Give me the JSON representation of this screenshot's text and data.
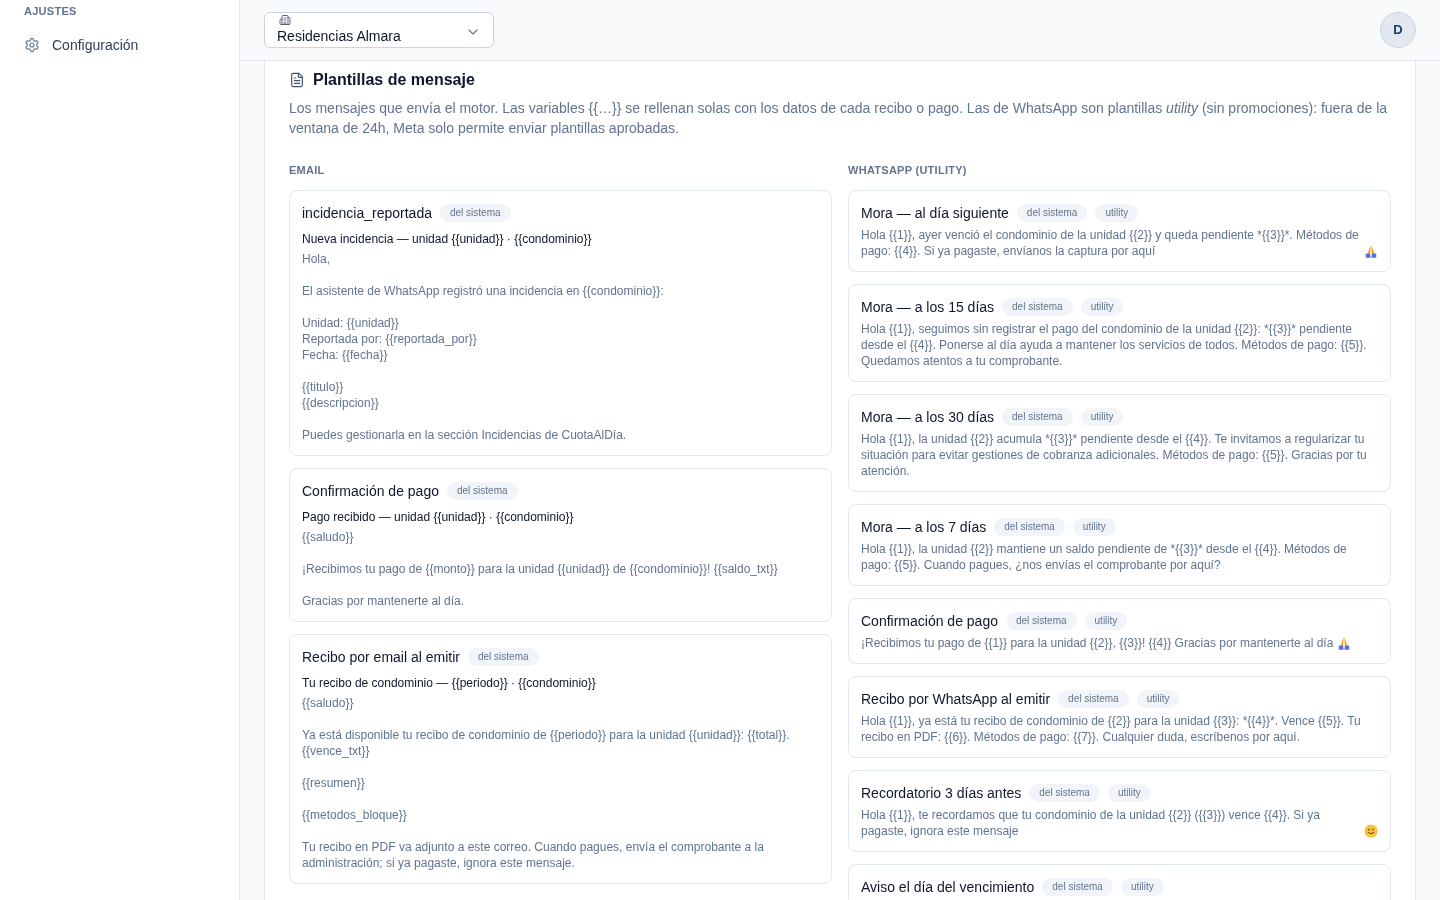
{
  "sidebar": {
    "section_label": "AJUSTES",
    "items": [
      {
        "label": "Configuración"
      }
    ]
  },
  "header": {
    "property_select": {
      "value": "Residencias Almara"
    },
    "avatar": {
      "initial": "D"
    }
  },
  "panel": {
    "title": "Plantillas de mensaje",
    "description": "Los mensajes que envía el motor. Las variables {{…}} se rellenan solas con los datos de cada recibo o pago. Las de WhatsApp son plantillas *utility* (sin promociones): fuera de la ventana de 24h, Meta solo permite enviar plantillas aprobadas.",
    "columns": [
      {
        "heading": "EMAIL",
        "templates": [
          {
            "name": "incidencia_reportada",
            "badges": [
              "del sistema"
            ],
            "subject": "Nueva incidencia — unidad {{unidad}} · {{condominio}}",
            "body": "Hola,\n\nEl asistente de WhatsApp registró una incidencia en {{condominio}}:\n\nUnidad: {{unidad}}\nReportada por: {{reportada_por}}\nFecha: {{fecha}}\n\n{{titulo}}\n{{descripcion}}\n\nPuedes gestionarla en la sección Incidencias de CuotaAlDía."
          },
          {
            "name": "Confirmación de pago",
            "badges": [
              "del sistema"
            ],
            "subject": "Pago recibido — unidad {{unidad}} · {{condominio}}",
            "body": "{{saludo}}\n\n¡Recibimos tu pago de {{monto}} para la unidad {{unidad}} de {{condominio}}! {{saldo_txt}}\n\nGracias por mantenerte al día."
          },
          {
            "name": "Recibo por email al emitir",
            "badges": [
              "del sistema"
            ],
            "subject": "Tu recibo de condominio — {{periodo}} · {{condominio}}",
            "body": "{{saludo}}\n\nYa está disponible tu recibo de condominio de {{periodo}} para la unidad {{unidad}}: {{total}}. {{vence_txt}}\n\n{{resumen}}\n\n{{metodos_bloque}}\n\nTu recibo en PDF va adjunto a este correo. Cuando pagues, envía el comprobante a la administración; si ya pagaste, ignora este mensaje."
          }
        ]
      },
      {
        "heading": "WHATSAPP (UTILITY)",
        "templates": [
          {
            "name": "Mora — al día siguiente",
            "badges": [
              "del sistema",
              "utility"
            ],
            "body": "Hola {{1}}, ayer venció el condominio de la unidad {{2}} y queda pendiente *{{3}}*. Métodos de pago: {{4}}. Si ya pagaste, envíanos la captura por aquí",
            "emoji": {
              "kind": "folded-hands"
            }
          },
          {
            "name": "Mora — a los 15 días",
            "badges": [
              "del sistema",
              "utility"
            ],
            "body": "Hola {{1}}, seguimos sin registrar el pago del condominio de la unidad {{2}}: *{{3}}* pendiente desde el {{4}}. Ponerse al día ayuda a mantener los servicios de todos. Métodos de pago: {{5}}. Quedamos atentos a tu comprobante."
          },
          {
            "name": "Mora — a los 30 días",
            "badges": [
              "del sistema",
              "utility"
            ],
            "body": "Hola {{1}}, la unidad {{2}} acumula *{{3}}* pendiente desde el {{4}}. Te invitamos a regularizar tu situación para evitar gestiones de cobranza adicionales. Métodos de pago: {{5}}. Gracias por tu atención."
          },
          {
            "name": "Mora — a los 7 días",
            "badges": [
              "del sistema",
              "utility"
            ],
            "body": "Hola {{1}}, la unidad {{2}} mantiene un saldo pendiente de *{{3}}* desde el {{4}}. Métodos de pago: {{5}}. Cuando pagues, ¿nos envías el comprobante por aquí?"
          },
          {
            "name": "Confirmación de pago",
            "badges": [
              "del sistema",
              "utility"
            ],
            "body": "¡Recibimos tu pago de {{1}} para la unidad {{2}}, {{3}}! {{4}} Gracias por mantenerte al día",
            "emoji": {
              "kind": "folded-hands"
            }
          },
          {
            "name": "Recibo por WhatsApp al emitir",
            "badges": [
              "del sistema",
              "utility"
            ],
            "body": "Hola {{1}}, ya está tu recibo de condominio de {{2}} para la unidad {{3}}: *{{4}}*. Vence {{5}}. Tu recibo en PDF: {{6}}. Métodos de pago: {{7}}. Cualquier duda, escríbenos por aquí."
          },
          {
            "name": "Recordatorio 3 días antes",
            "badges": [
              "del sistema",
              "utility"
            ],
            "body": "Hola {{1}}, te recordamos que tu condominio de la unidad {{2}} ({{3}}) vence {{4}}. Si ya pagaste, ignora este mensaje",
            "emoji": {
              "kind": "slightly-smiling-face"
            }
          },
          {
            "name": "Aviso el día del vencimiento",
            "badges": [
              "del sistema",
              "utility"
            ]
          }
        ]
      }
    ]
  }
}
